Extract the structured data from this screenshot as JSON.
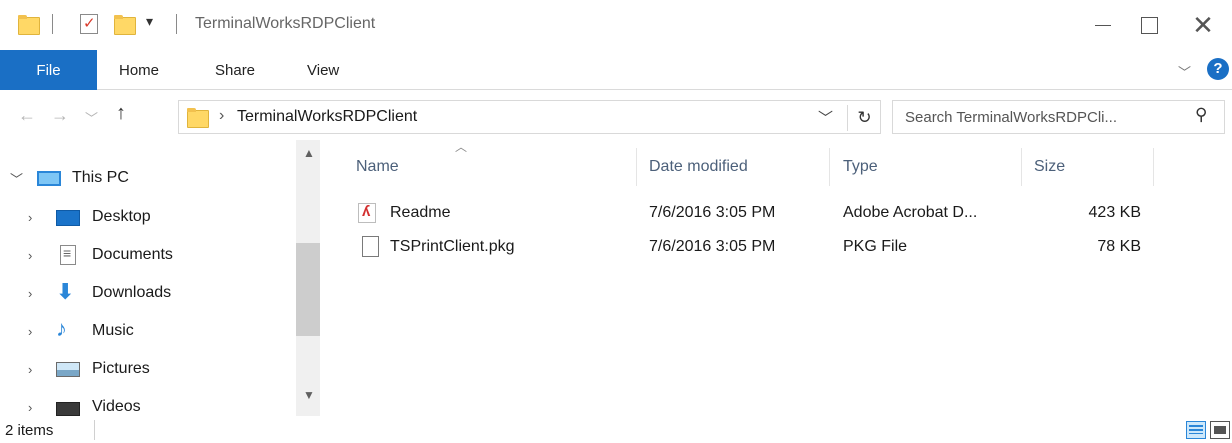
{
  "window": {
    "title": "TerminalWorksRDPClient"
  },
  "ribbon": {
    "tabs": [
      {
        "label": "File"
      },
      {
        "label": "Home"
      },
      {
        "label": "Share"
      },
      {
        "label": "View"
      }
    ]
  },
  "address": {
    "crumb": "TerminalWorksRDPClient"
  },
  "search": {
    "placeholder": "Search TerminalWorksRDPCli..."
  },
  "sidebar": {
    "root": "This PC",
    "items": [
      {
        "label": "Desktop",
        "icon": "desktop-icon"
      },
      {
        "label": "Documents",
        "icon": "documents-icon"
      },
      {
        "label": "Downloads",
        "icon": "downloads-icon"
      },
      {
        "label": "Music",
        "icon": "music-icon"
      },
      {
        "label": "Pictures",
        "icon": "pictures-icon"
      },
      {
        "label": "Videos",
        "icon": "videos-icon"
      }
    ]
  },
  "columns": {
    "name": "Name",
    "date": "Date modified",
    "type": "Type",
    "size": "Size"
  },
  "files": [
    {
      "name": "Readme",
      "date": "7/6/2016 3:05 PM",
      "type": "Adobe Acrobat D...",
      "size": "423 KB",
      "icon": "pdf-file-icon"
    },
    {
      "name": "TSPrintClient.pkg",
      "date": "7/6/2016 3:05 PM",
      "type": "PKG File",
      "size": "78 KB",
      "icon": "generic-file-icon"
    }
  ],
  "status": {
    "item_count": "2 items"
  },
  "colors": {
    "accent": "#1a6fc5",
    "header_text": "#4c607a",
    "folder": "#ffd866"
  }
}
